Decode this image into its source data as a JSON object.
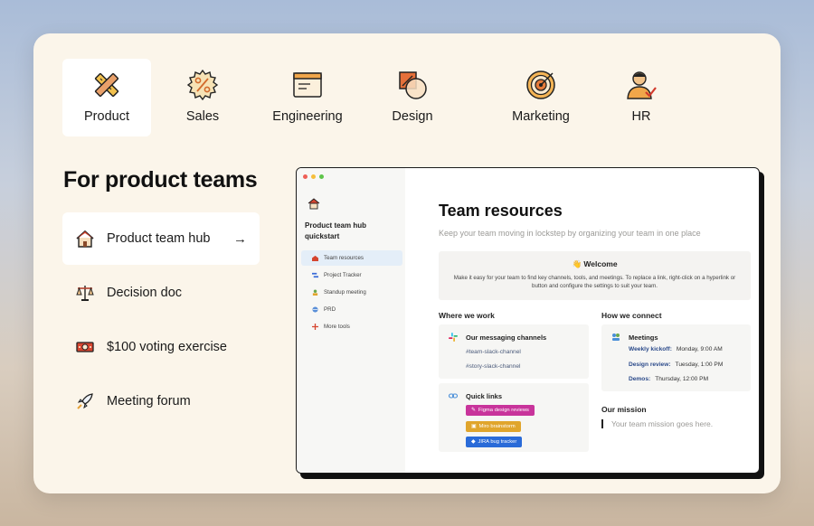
{
  "tabs": [
    {
      "label": "Product",
      "icon": "pencil-ruler-icon",
      "active": true
    },
    {
      "label": "Sales",
      "icon": "percent-gear-icon",
      "active": false
    },
    {
      "label": "Engineering",
      "icon": "browser-window-icon",
      "active": false
    },
    {
      "label": "Design",
      "icon": "shapes-icon",
      "active": false
    },
    {
      "label": "Marketing",
      "icon": "target-icon",
      "active": false
    },
    {
      "label": "HR",
      "icon": "person-check-icon",
      "active": false
    }
  ],
  "heading": "For product teams",
  "templates": [
    {
      "label": "Product team hub",
      "icon": "house-icon",
      "arrow": "→",
      "active": true
    },
    {
      "label": "Decision doc",
      "icon": "scales-icon",
      "active": false
    },
    {
      "label": "$100 voting exercise",
      "icon": "dollar-bill-icon",
      "active": false
    },
    {
      "label": "Meeting forum",
      "icon": "rocket-icon",
      "active": false
    }
  ],
  "preview": {
    "workspace_title": "Product team hub quickstart",
    "nav": [
      {
        "label": "Team resources",
        "icon": "house-icon",
        "active": true
      },
      {
        "label": "Project Tracker",
        "icon": "tracker-icon",
        "active": false
      },
      {
        "label": "Standup meeting",
        "icon": "people-icon",
        "active": false
      },
      {
        "label": "PRD",
        "icon": "globe-icon",
        "active": false
      },
      {
        "label": "More tools",
        "icon": "plus-icon",
        "active": false
      }
    ],
    "title": "Team resources",
    "subtitle": "Keep your team moving in lockstep by organizing your team in one place",
    "callout": {
      "title": "👋 Welcome",
      "body": "Make it easy for your team to find key channels, tools, and meetings. To replace a link, right-click on a hyperlink or button and configure the settings to suit your team."
    },
    "where_we_work": "Where we work",
    "messaging": {
      "heading": "Our messaging channels",
      "channels": [
        "#team-slack-channel",
        "#story-slack-channel"
      ]
    },
    "quick_links": {
      "heading": "Quick links",
      "tags": [
        {
          "label": "Figma design reviews",
          "color": "#c8349b"
        },
        {
          "label": "Miro brainstorm",
          "color": "#e0a52c"
        },
        {
          "label": "JIRA bug tracker",
          "color": "#2a6bd8"
        }
      ]
    },
    "how_we_connect": "How we connect",
    "meetings": {
      "heading": "Meetings",
      "rows": [
        {
          "name": "Weekly kickoff:",
          "time": "Monday, 9:00 AM"
        },
        {
          "name": "Design review:",
          "time": "Tuesday, 1:00 PM"
        },
        {
          "name": "Demos:",
          "time": "Thursday, 12:00 PM"
        }
      ]
    },
    "mission_heading": "Our mission",
    "mission_placeholder": "Your team mission goes here."
  }
}
